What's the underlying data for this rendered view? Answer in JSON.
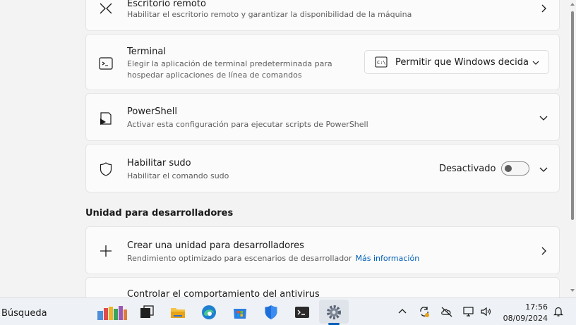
{
  "remote_desktop": {
    "title": "Escritorio remoto",
    "description": "Habilitar el escritorio remoto y garantizar la disponibilidad de la máquina"
  },
  "terminal": {
    "title": "Terminal",
    "description_line1": "Elegir la aplicación de terminal predeterminada para",
    "description_line2": "hospedar aplicaciones de línea de comandos",
    "dropdown_value": "Permitir que Windows decida"
  },
  "powershell": {
    "title": "PowerShell",
    "description": "Activar esta configuración para ejecutar scripts de PowerShell"
  },
  "sudo": {
    "title": "Habilitar sudo",
    "description": "Habilitar el comando sudo",
    "toggle_label": "Desactivado",
    "toggle_on": false
  },
  "dev_drive_section": {
    "heading": "Unidad para desarrolladores"
  },
  "dev_drive": {
    "title": "Crear una unidad para desarrolladores",
    "description": "Rendimiento optimizado para escenarios de desarrollador",
    "link": "Más información"
  },
  "antivirus": {
    "title": "Controlar el comportamiento del antivirus"
  },
  "taskbar": {
    "search_label": "Búsqueda",
    "apps": [
      "books-widget-icon",
      "task-view-icon",
      "file-explorer-icon",
      "edge-icon",
      "store-icon",
      "defender-icon",
      "terminal-icon",
      "settings-icon"
    ],
    "time": "17:56",
    "date": "08/09/2024"
  },
  "colors": {
    "accent": "#005fb8",
    "card_bg": "#fbfbfb",
    "page_bg": "#f3f3f3"
  }
}
